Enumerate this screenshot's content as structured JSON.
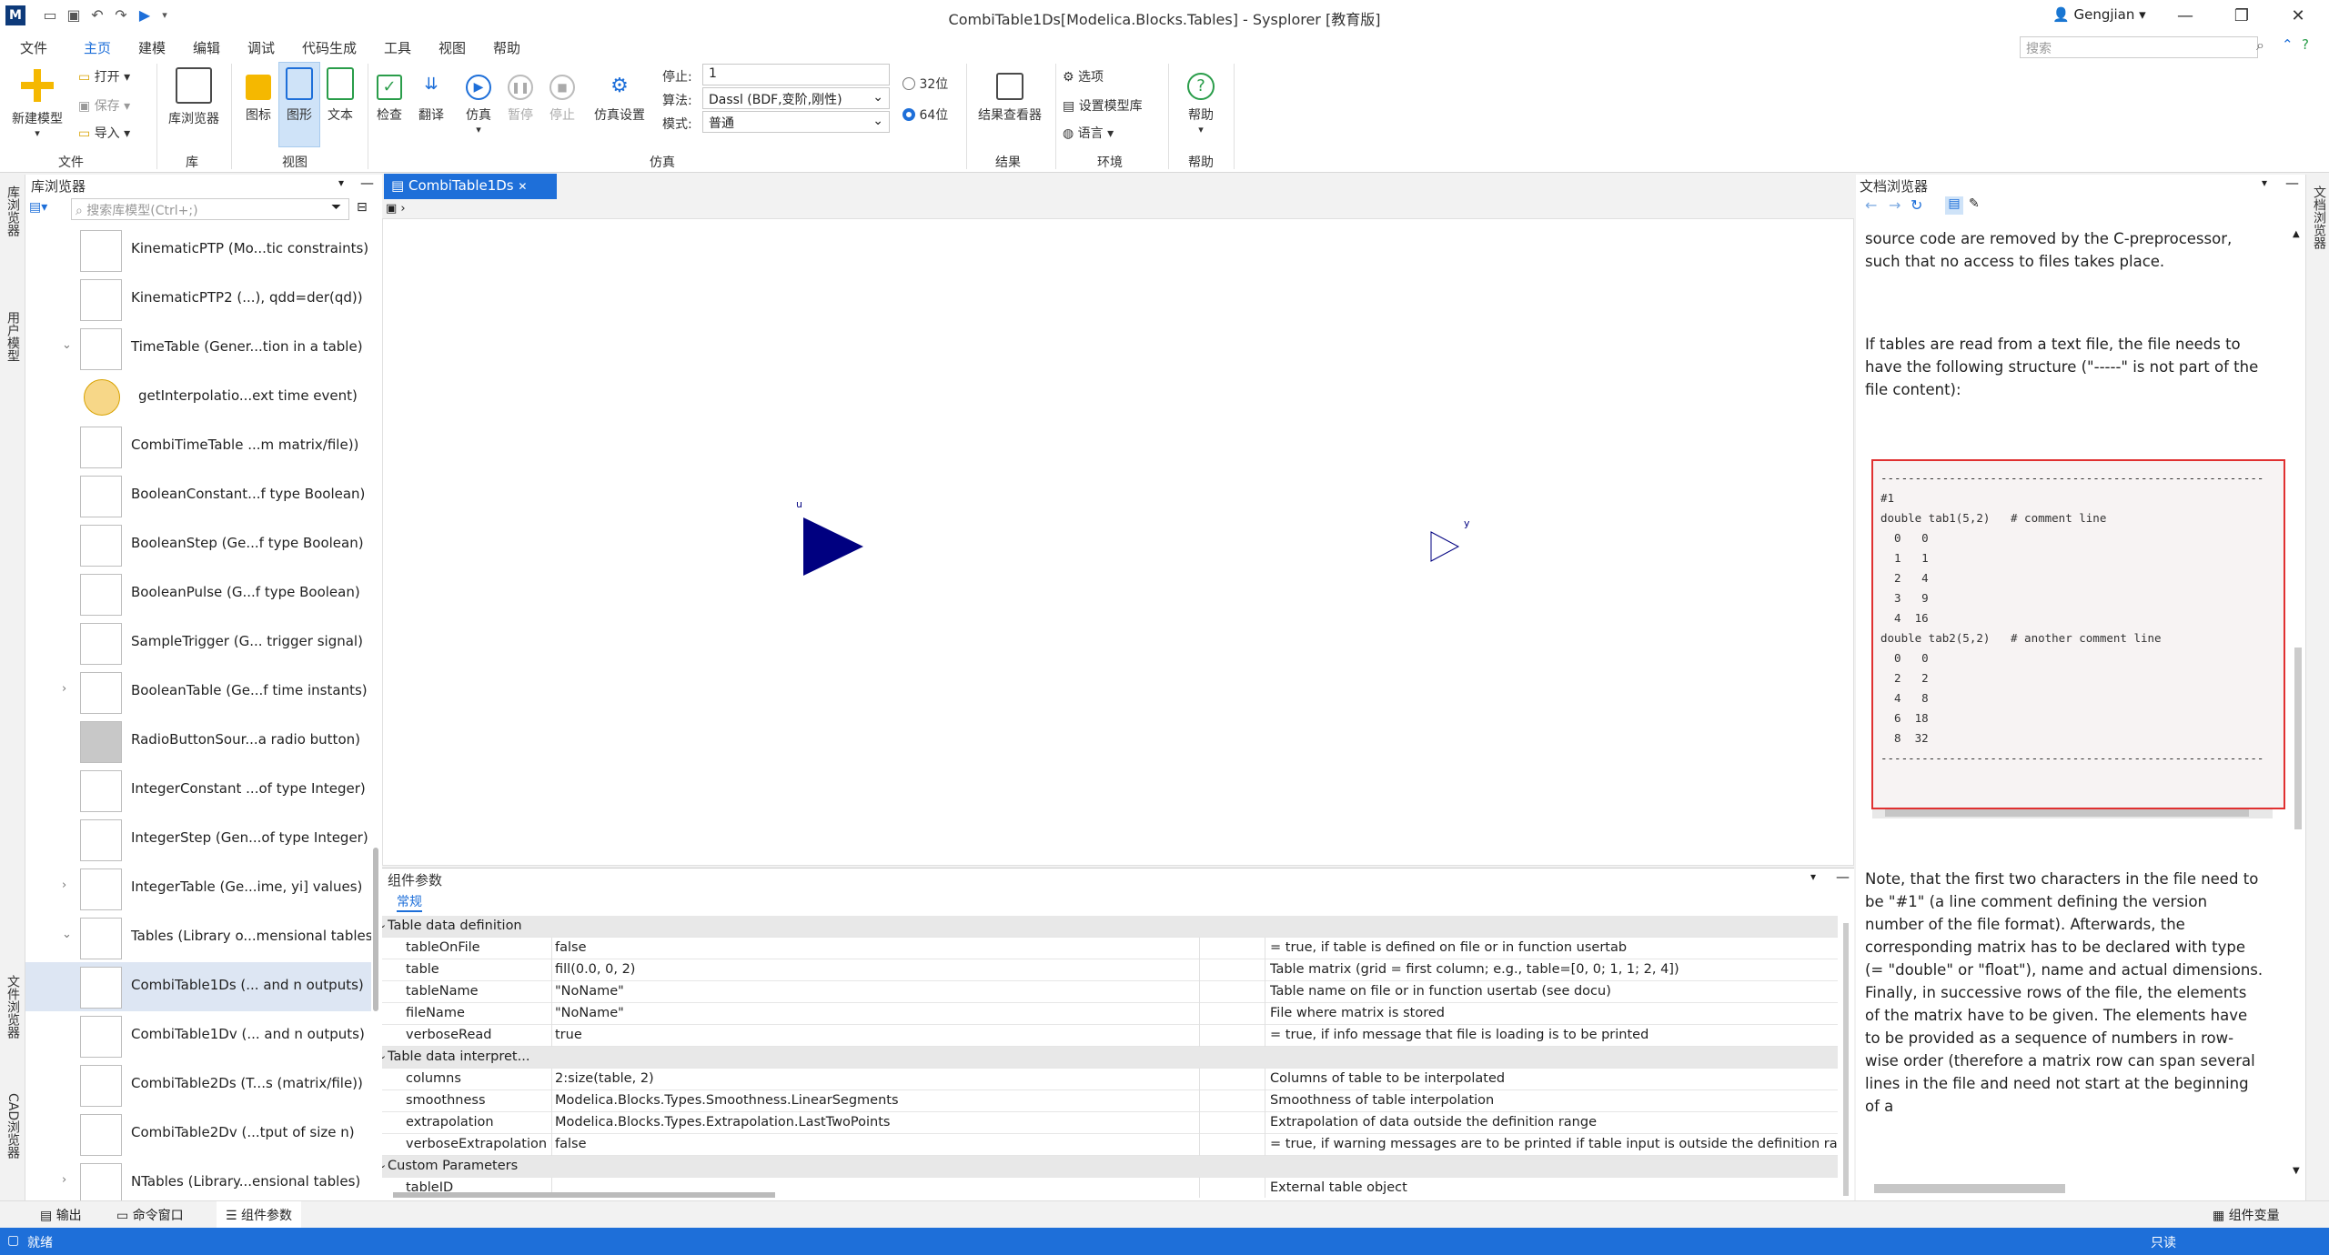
{
  "app": {
    "title": "CombiTable1Ds[Modelica.Blocks.Tables] - Sysplorer [教育版]",
    "user": "Gengjian"
  },
  "menu": [
    "文件",
    "主页",
    "建模",
    "编辑",
    "调试",
    "代码生成",
    "工具",
    "视图",
    "帮助"
  ],
  "search_placeholder": "搜索",
  "ribbon": {
    "new_model": "新建模型",
    "open": "打开",
    "save": "保存",
    "import": "导入",
    "lib_browser": "库浏览器",
    "icon_view": "图标",
    "diagram_view": "图形",
    "text_view": "文本",
    "check": "检查",
    "translate": "翻译",
    "simulate": "仿真",
    "pause": "暂停",
    "stop": "停止",
    "sim_settings": "仿真设置",
    "stop_label": "停止:",
    "stop_value": "1",
    "algo_label": "算法:",
    "algo_value": "Dassl (BDF,变阶,刚性)",
    "mode_label": "模式:",
    "mode_value": "普通",
    "bit32": "32位",
    "bit64": "64位",
    "result_viewer": "结果查看器",
    "options": "选项",
    "set_lib": "设置模型库",
    "language": "语言",
    "help": "帮助",
    "groups": [
      "文件",
      "库",
      "视图",
      "仿真",
      "结果",
      "环境",
      "帮助"
    ]
  },
  "left_strip": {
    "lib": "库浏览器",
    "user": "用户模型",
    "file": "文件浏览器",
    "cad": "CAD浏览器"
  },
  "lib": {
    "title": "库浏览器",
    "search_placeholder": "搜索库模型(Ctrl+;)",
    "items": [
      {
        "label": "KinematicPTP (Mo...tic constraints)",
        "chev": ""
      },
      {
        "label": "KinematicPTP2 (...), qdd=der(qd))",
        "chev": ""
      },
      {
        "label": "TimeTable (Gener...tion in a table)",
        "chev": "⌄"
      },
      {
        "label": "getInterpolatio...ext time event)",
        "chev": ""
      },
      {
        "label": "CombiTimeTable ...m matrix/file))",
        "chev": ""
      },
      {
        "label": "BooleanConstant...f type Boolean)",
        "chev": ""
      },
      {
        "label": "BooleanStep (Ge...f type Boolean)",
        "chev": ""
      },
      {
        "label": "BooleanPulse (G...f type Boolean)",
        "chev": ""
      },
      {
        "label": "SampleTrigger (G... trigger signal)",
        "chev": ""
      },
      {
        "label": "BooleanTable (Ge...f time instants)",
        "chev": "›"
      },
      {
        "label": "RadioButtonSour...a radio button)",
        "chev": ""
      },
      {
        "label": "IntegerConstant ...of type Integer)",
        "chev": ""
      },
      {
        "label": "IntegerStep (Gen...of type Integer)",
        "chev": ""
      },
      {
        "label": "IntegerTable (Ge...ime, yi] values)",
        "chev": "›"
      },
      {
        "label": "Tables (Library o...mensional tables)",
        "chev": "⌄"
      },
      {
        "label": "CombiTable1Ds (... and n outputs)",
        "chev": ""
      },
      {
        "label": "CombiTable1Dv (... and n outputs)",
        "chev": ""
      },
      {
        "label": "CombiTable2Ds (T...s (matrix/file))",
        "chev": ""
      },
      {
        "label": "CombiTable2Dv (...tput of size n)",
        "chev": ""
      },
      {
        "label": "NTables (Library...ensional tables)",
        "chev": "›"
      }
    ]
  },
  "editor": {
    "tab": "CombiTable1Ds",
    "port_u": "u",
    "port_y": "y"
  },
  "params": {
    "title": "组件参数",
    "tab": "常规",
    "rows": [
      {
        "group": true,
        "name": "Table data definition"
      },
      {
        "name": "tableOnFile",
        "value": "false",
        "desc": "= true, if table is defined on file or in function usertab"
      },
      {
        "name": "table",
        "value": "fill(0.0, 0, 2)",
        "desc": "Table matrix (grid = first column; e.g., table=[0, 0; 1, 1; 2, 4])"
      },
      {
        "name": "tableName",
        "value": "\"NoName\"",
        "desc": "Table name on file or in function usertab (see docu)"
      },
      {
        "name": "fileName",
        "value": "\"NoName\"",
        "desc": "File where matrix is stored"
      },
      {
        "name": "verboseRead",
        "value": "true",
        "desc": "= true, if info message that file is loading is to be printed"
      },
      {
        "group": true,
        "name": "Table data interpret..."
      },
      {
        "name": "columns",
        "value": "2:size(table, 2)",
        "desc": "Columns of table to be interpolated"
      },
      {
        "name": "smoothness",
        "value": "Modelica.Blocks.Types.Smoothness.LinearSegments",
        "desc": "Smoothness of table interpolation"
      },
      {
        "name": "extrapolation",
        "value": "Modelica.Blocks.Types.Extrapolation.LastTwoPoints",
        "desc": "Extrapolation of data outside the definition range"
      },
      {
        "name": "verboseExtrapolation",
        "value": "false",
        "desc": "= true, if warning messages are to be printed if table input is outside the definition ran"
      },
      {
        "group": true,
        "name": "Custom Parameters"
      },
      {
        "name": "tableID",
        "value": "",
        "desc": "External table object"
      }
    ]
  },
  "doc": {
    "title": "文档浏览器",
    "p1": "source code are removed by the C-preprocessor, such that no access to files takes place.",
    "p2": "If tables are read from a text file, the file needs to have the following structure (\"-----\" is not part of the file content):",
    "code": "--------------------------------------------------------\n#1\ndouble tab1(5,2)   # comment line\n  0   0\n  1   1\n  2   4\n  3   9\n  4  16\ndouble tab2(5,2)   # another comment line\n  0   0\n  2   2\n  4   8\n  6  18\n  8  32\n--------------------------------------------------------",
    "p3": "Note, that the first two characters in the file need to be \"#1\" (a line comment defining the version number of the file format). Afterwards, the corresponding matrix has to be declared with type (= \"double\" or \"float\"), name and actual dimensions. Finally, in successive rows of the file, the elements of the matrix have to be given. The elements have to be provided as a sequence of numbers in row-wise order (therefore a matrix row can span several lines in the file and need not start at the beginning of a"
  },
  "right_strip": {
    "doc": "文档浏览器"
  },
  "bottom_tabs": [
    "输出",
    "命令窗口",
    "组件参数"
  ],
  "bottom_right": "组件变量",
  "status": {
    "left": "就绪",
    "right": "只读"
  }
}
